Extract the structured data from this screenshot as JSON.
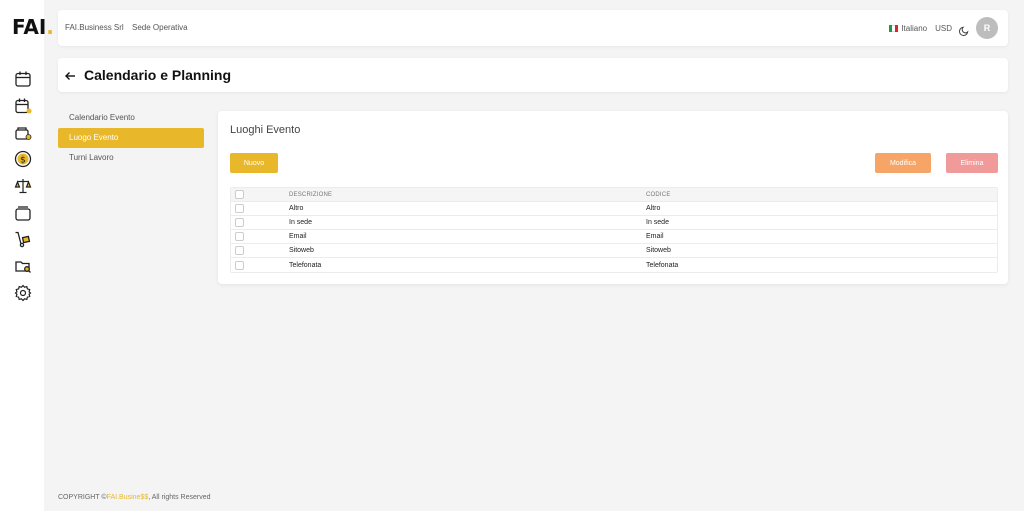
{
  "brand": {
    "logo_text": "FAI",
    "logo_dot": "."
  },
  "sidebar_icons": [
    "calendar-icon",
    "calendar-user-icon",
    "wallet-icon",
    "dollar-coin-icon",
    "scales-icon",
    "stack-icon",
    "hand-truck-icon",
    "folder-search-icon",
    "gear-icon"
  ],
  "topbar": {
    "company": "FAI.Business Srl",
    "location": "Sede Operativa",
    "language": "Italiano",
    "currency": "USD",
    "avatar_initial": "R"
  },
  "page": {
    "title": "Calendario e Planning"
  },
  "submenu": {
    "items": [
      {
        "label": "Calendario Evento"
      },
      {
        "label": "Luogo Evento"
      },
      {
        "label": "Turni Lavoro"
      }
    ],
    "active_index": 1
  },
  "card": {
    "title": "Luoghi Evento",
    "buttons": {
      "new": "Nuovo",
      "edit": "Modifica",
      "delete": "Elimina"
    },
    "table": {
      "columns": [
        "DESCRIZIONE",
        "CODICE"
      ],
      "rows": [
        {
          "descrizione": "Altro",
          "codice": "Altro"
        },
        {
          "descrizione": "In sede",
          "codice": "In sede"
        },
        {
          "descrizione": "Email",
          "codice": "Email"
        },
        {
          "descrizione": "Sitoweb",
          "codice": "Sitoweb"
        },
        {
          "descrizione": "Telefonata",
          "codice": "Telefonata"
        }
      ]
    }
  },
  "footer": {
    "prefix": "COPYRIGHT ©",
    "brand": "FAI.Busine$$",
    "suffix": ", All rights Reserved"
  },
  "colors": {
    "accent": "#e8b82a",
    "edit": "#f7a467",
    "delete": "#f09a9a",
    "background": "#f4f4f5"
  }
}
